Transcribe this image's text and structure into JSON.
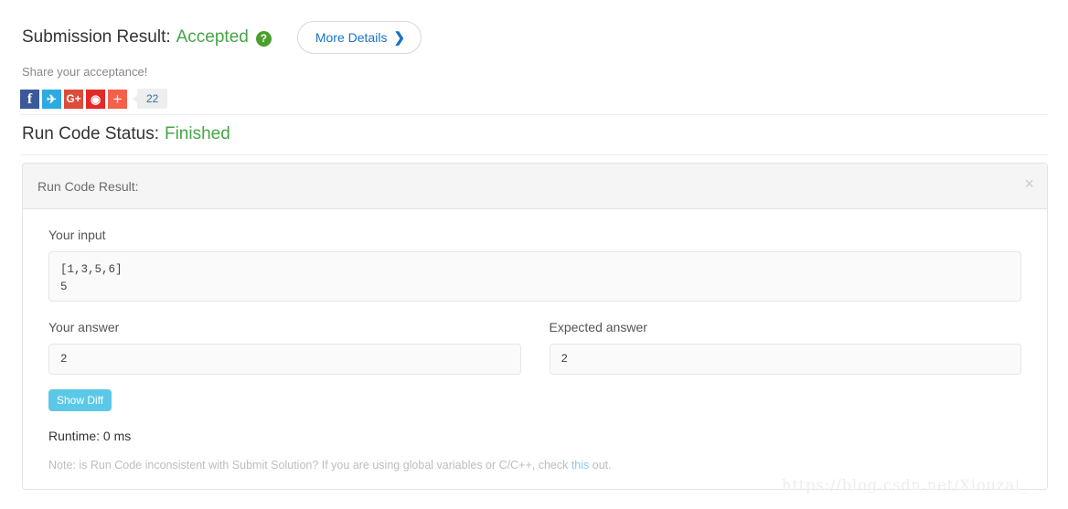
{
  "submission": {
    "label": "Submission Result:",
    "status": "Accepted",
    "help_icon": "question-mark-circle-icon",
    "more_details_label": "More Details",
    "more_details_chevron": "❯",
    "status_color": "#46a546"
  },
  "share": {
    "caption": "Share your acceptance!",
    "count": "22",
    "buttons": [
      {
        "name": "facebook",
        "glyph": "f",
        "color": "#3b5998"
      },
      {
        "name": "twitter",
        "glyph": "✈",
        "color": "#2daae1"
      },
      {
        "name": "google-plus",
        "glyph": "G+",
        "color": "#dd4b39"
      },
      {
        "name": "weibo",
        "glyph": "◉",
        "color": "#e32929"
      },
      {
        "name": "more-share",
        "glyph": "+",
        "color": "#f4604b"
      }
    ]
  },
  "run_status": {
    "label": "Run Code Status:",
    "value": "Finished",
    "value_color": "#46a546"
  },
  "panel": {
    "title": "Run Code Result:",
    "close_icon": "×",
    "your_input_label": "Your input",
    "your_input_value": "[1,3,5,6]\n5",
    "your_answer_label": "Your answer",
    "your_answer_value": "2",
    "expected_answer_label": "Expected answer",
    "expected_answer_value": "2",
    "show_diff_label": "Show Diff",
    "show_diff_color": "#5bc8e8",
    "runtime_text": "Runtime: 0 ms",
    "note_prefix": "Note: is Run Code inconsistent with Submit Solution? If you are using global variables or C/C++, check ",
    "note_link": "this",
    "note_suffix": " out."
  },
  "watermark": "https://blog.csdn.net/Xiouzai_"
}
